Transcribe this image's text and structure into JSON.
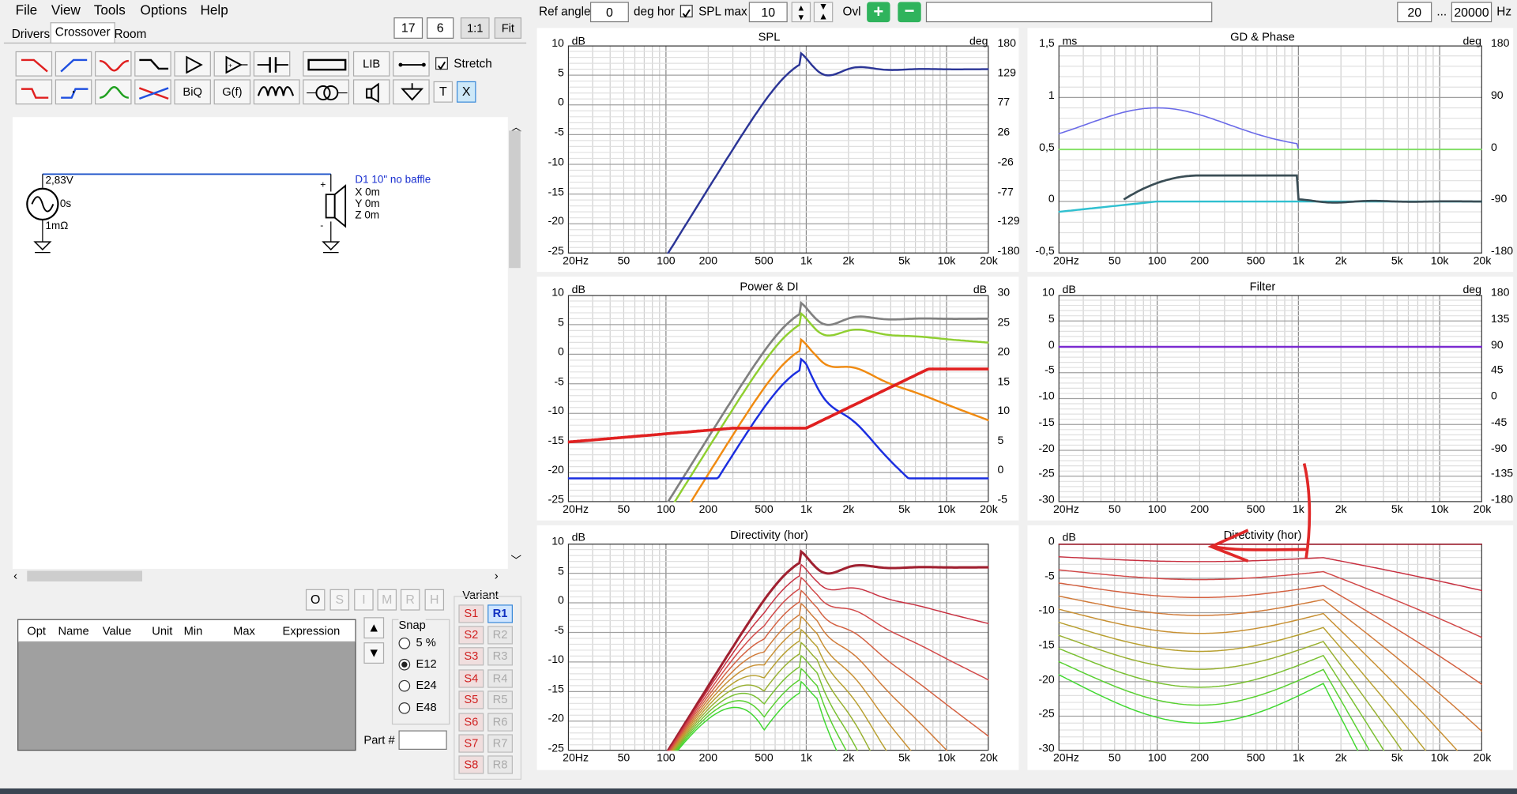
{
  "menu": [
    "File",
    "View",
    "Tools",
    "Options",
    "Help"
  ],
  "tabs": [
    "Drivers",
    "Crossover",
    "Room"
  ],
  "active_tab": "Crossover",
  "grid": {
    "cols": "17",
    "rows": "6",
    "zoom_label": "1:1",
    "fit_label": "Fit"
  },
  "toolbar": {
    "lib_label": "LIB",
    "biq_label": "BiQ",
    "gf_label": "G(f)",
    "t_label": "T",
    "x_label": "X",
    "stretch_label": "Stretch",
    "stretch_checked": true
  },
  "schematic": {
    "voltage": "2,83V",
    "delay": "0s",
    "resistance": "1mΩ",
    "driver_name": "D1 10\" no baffle",
    "x": "X 0m",
    "y": "Y 0m",
    "z": "Z 0m"
  },
  "bottom_buttons": [
    "O",
    "S",
    "I",
    "M",
    "R",
    "H"
  ],
  "opt_table": {
    "columns": [
      "Opt",
      "Name",
      "Value",
      "Unit",
      "Min",
      "Max",
      "Expression"
    ]
  },
  "snap": {
    "title": "Snap",
    "options": [
      "5 %",
      "E12",
      "E24",
      "E48"
    ],
    "selected": "E12"
  },
  "part_label": "Part #",
  "variant": {
    "title": "Variant",
    "s": [
      "S1",
      "S2",
      "S3",
      "S4",
      "S5",
      "S6",
      "S7",
      "S8"
    ],
    "r": [
      "R1",
      "R2",
      "R3",
      "R4",
      "R5",
      "R6",
      "R7",
      "R8"
    ],
    "selected": "R1"
  },
  "top": {
    "ref_angle_label": "Ref angle",
    "ref_angle": "0",
    "deg_hor": "deg hor",
    "spl_max_label": "SPL max",
    "spl_max_checked": true,
    "spl_max": "10",
    "ovl_label": "Ovl",
    "f_min": "20",
    "dots": "...",
    "f_max": "20000",
    "hz": "Hz"
  },
  "colors": {
    "spl": "#2b3596",
    "phase": "#6a6ae8",
    "gd": "#3a4d55",
    "cyan": "#30c0d0",
    "green": "#80e060",
    "power": "#808080",
    "di": "#e02020",
    "filter": "#7b2bd0",
    "arrow": "#e02828"
  },
  "panels": [
    {
      "id": "spl",
      "title": "SPL",
      "ylabel": "dB",
      "rlabel": "deg",
      "yticks": [
        "10",
        "5",
        "0",
        "-5",
        "-10",
        "-15",
        "-20",
        "-25"
      ],
      "rticks": [
        "180",
        "129",
        "77",
        "26",
        "-26",
        "-77",
        "-129",
        "-180"
      ],
      "xticks": [
        "20Hz",
        "50",
        "100",
        "200",
        "500",
        "1k",
        "2k",
        "5k",
        "10k",
        "20k"
      ]
    },
    {
      "id": "gd",
      "title": "GD & Phase",
      "ylabel": "ms",
      "rlabel": "deg",
      "yticks": [
        "1,5",
        "1",
        "0,5",
        "0",
        "-0,5"
      ],
      "rticks": [
        "180",
        "90",
        "0",
        "-90",
        "-180"
      ],
      "xticks": [
        "20Hz",
        "50",
        "100",
        "200",
        "500",
        "1k",
        "2k",
        "5k",
        "10k",
        "20k"
      ]
    },
    {
      "id": "power",
      "title": "Power & DI",
      "ylabel": "dB",
      "rlabel": "dB",
      "yticks": [
        "10",
        "5",
        "0",
        "-5",
        "-10",
        "-15",
        "-20",
        "-25"
      ],
      "rticks": [
        "30",
        "25",
        "20",
        "15",
        "10",
        "5",
        "0",
        "-5"
      ],
      "xticks": [
        "20Hz",
        "50",
        "100",
        "200",
        "500",
        "1k",
        "2k",
        "5k",
        "10k",
        "20k"
      ]
    },
    {
      "id": "filter",
      "title": "Filter",
      "ylabel": "dB",
      "rlabel": "deg",
      "yticks": [
        "10",
        "5",
        "0",
        "-5",
        "-10",
        "-15",
        "-20",
        "-25",
        "-30"
      ],
      "rticks": [
        "180",
        "135",
        "90",
        "45",
        "0",
        "-45",
        "-90",
        "-135",
        "-180"
      ],
      "xticks": [
        "20Hz",
        "50",
        "100",
        "200",
        "500",
        "1k",
        "2k",
        "5k",
        "10k",
        "20k"
      ]
    },
    {
      "id": "dir1",
      "title": "Directivity (hor)",
      "ylabel": "dB",
      "rlabel": "",
      "yticks": [
        "10",
        "5",
        "0",
        "-5",
        "-10",
        "-15",
        "-20",
        "-25"
      ],
      "rticks": [],
      "xticks": [
        "20Hz",
        "50",
        "100",
        "200",
        "500",
        "1k",
        "2k",
        "5k",
        "10k",
        "20k"
      ]
    },
    {
      "id": "dir2",
      "title": "Directivity (hor)",
      "ylabel": "dB",
      "rlabel": "",
      "yticks": [
        "0",
        "-5",
        "-10",
        "-15",
        "-20",
        "-25",
        "-30"
      ],
      "rticks": [],
      "xticks": [
        "20Hz",
        "50",
        "100",
        "200",
        "500",
        "1k",
        "2k",
        "5k",
        "10k",
        "20k"
      ]
    }
  ]
}
